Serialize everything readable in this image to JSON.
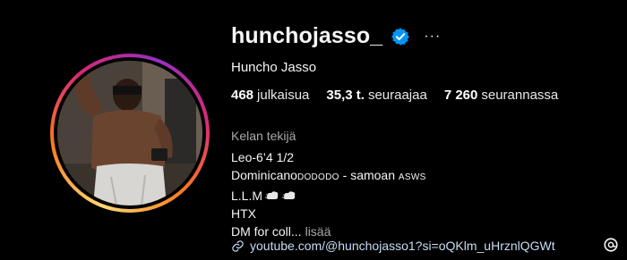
{
  "profile": {
    "username": "hunchojasso_",
    "full_name": "Huncho Jasso",
    "more_label": "···"
  },
  "stats": {
    "posts_count": "468",
    "posts_label": "julkaisua",
    "followers_count": "35,3 t.",
    "followers_label": "seuraajaa",
    "following_count": "7 260",
    "following_label": "seurannassa"
  },
  "bio": {
    "category": "Kelan tekijä",
    "line1": "Leo-6’4 1/2",
    "line2_main": "Dominicano",
    "line2_caps1": "DODODO",
    "line2_mid": " - samoan ",
    "line2_caps2": "ASWS",
    "line3": "L.L.M",
    "line4": "HTX",
    "line5": "DM for coll...",
    "more": "lisää"
  },
  "link": {
    "url": "youtube.com/@hunchojasso1?si=oQKlm_uHrznlQGWt"
  },
  "icons": {
    "verified": "verified-badge-icon",
    "link": "link-icon",
    "threads": "threads-icon",
    "emoji": "dash-smoke-emoji"
  },
  "colors": {
    "background": "#000000",
    "verified_blue": "#0095f6",
    "muted_text": "#a8a8a8",
    "link_text": "#c7dcf4"
  }
}
